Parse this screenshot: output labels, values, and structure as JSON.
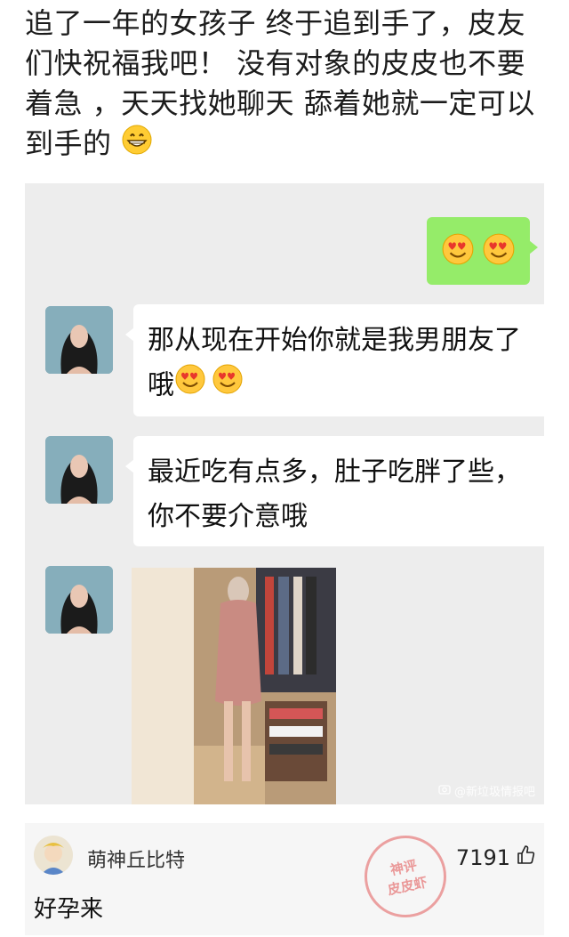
{
  "post": {
    "text": "追了一年的女孩子 终于追到手了，皮友们快祝福我吧！ 没有对象的皮皮也不要着急 ，天天找她聊天 舔着她就一定可以到手的",
    "trailing_emoji": "grinning-face-icon"
  },
  "chat": {
    "messages": [
      {
        "side": "right",
        "content": "",
        "emojis": [
          "smiling-face-with-heart-eyes-icon",
          "smiling-face-with-heart-eyes-icon"
        ]
      },
      {
        "side": "left",
        "text": "那从现在开始你就是我男朋友了哦",
        "emojis": [
          "smiling-face-with-heart-eyes-icon",
          "smiling-face-with-heart-eyes-icon"
        ]
      },
      {
        "side": "left",
        "text": "最近吃有点多，肚子吃胖了些，你不要介意哦"
      },
      {
        "side": "left",
        "image": "mirror-selfie-photo"
      }
    ],
    "watermark": "@新垃圾情报吧",
    "colors": {
      "background": "#ededed",
      "sent_bubble": "#95ec69",
      "received_bubble": "#ffffff"
    }
  },
  "comment": {
    "username": "萌神丘比特",
    "text": "好孕来",
    "likes": "7191",
    "stamp_line1": "神评",
    "stamp_line2": "皮皮虾"
  }
}
